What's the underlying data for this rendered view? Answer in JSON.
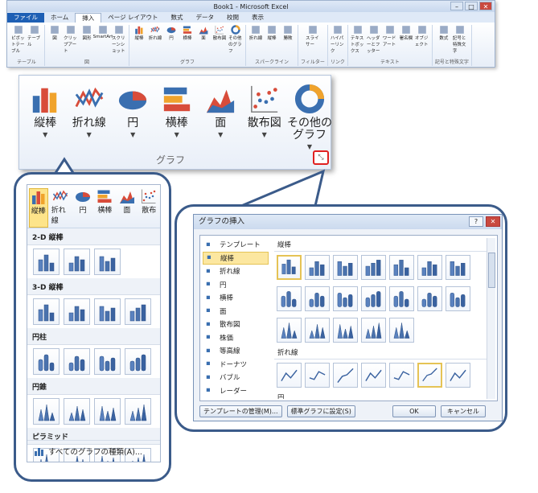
{
  "excel": {
    "title": "Book1 - Microsoft Excel",
    "tabs": [
      "ファイル",
      "ホーム",
      "挿入",
      "ページ レイアウト",
      "数式",
      "データ",
      "校閲",
      "表示"
    ],
    "active_tab": "挿入",
    "groups": [
      {
        "name": "テーブル",
        "items": [
          "ピボットテーブル",
          "テーブル"
        ]
      },
      {
        "name": "図",
        "items": [
          "図",
          "クリップアート",
          "図形",
          "SmartArt",
          "スクリーンショット"
        ]
      },
      {
        "name": "グラフ",
        "items": [
          "縦棒",
          "折れ線",
          "円",
          "横棒",
          "面",
          "散布図",
          "その他のグラフ"
        ]
      },
      {
        "name": "スパークライン",
        "items": [
          "折れ線",
          "縦棒",
          "勝敗"
        ]
      },
      {
        "name": "フィルター",
        "items": [
          "スライサー"
        ]
      },
      {
        "name": "リンク",
        "items": [
          "ハイパーリンク"
        ]
      },
      {
        "name": "テキスト",
        "items": [
          "テキストボックス",
          "ヘッダーとフッター",
          "ワードアート",
          "署名欄",
          "オブジェクト"
        ]
      },
      {
        "name": "記号と特殊文字",
        "items": [
          "数式",
          "記号と特殊文字"
        ]
      }
    ]
  },
  "zoom": {
    "items": [
      {
        "label": "縦棒"
      },
      {
        "label": "折れ線"
      },
      {
        "label": "円"
      },
      {
        "label": "横棒"
      },
      {
        "label": "面"
      },
      {
        "label": "散布図"
      },
      {
        "label": "その他の\nグラフ"
      }
    ],
    "group_name": "グラフ"
  },
  "dropdown": {
    "top_items": [
      "縦棒",
      "折れ線",
      "円",
      "横棒",
      "面",
      "散布"
    ],
    "sections": [
      {
        "title": "2-D 縦棒",
        "count": 3
      },
      {
        "title": "3-D 縦棒",
        "count": 4
      },
      {
        "title": "円柱",
        "count": 4
      },
      {
        "title": "円錐",
        "count": 4
      },
      {
        "title": "ピラミッド",
        "count": 4
      }
    ],
    "footer": "すべてのグラフの種類(A)..."
  },
  "dialog": {
    "title": "グラフの挿入",
    "types": [
      "テンプレート",
      "縦棒",
      "折れ線",
      "円",
      "横棒",
      "面",
      "散布図",
      "株価",
      "等高線",
      "ドーナツ",
      "バブル",
      "レーダー"
    ],
    "selected_type": "縦棒",
    "gallery_sections": [
      "縦棒",
      "折れ線",
      "円"
    ],
    "buttons": {
      "manage": "テンプレートの管理(M)...",
      "default": "標準グラフに設定(S)",
      "ok": "OK",
      "cancel": "キャンセル"
    }
  }
}
